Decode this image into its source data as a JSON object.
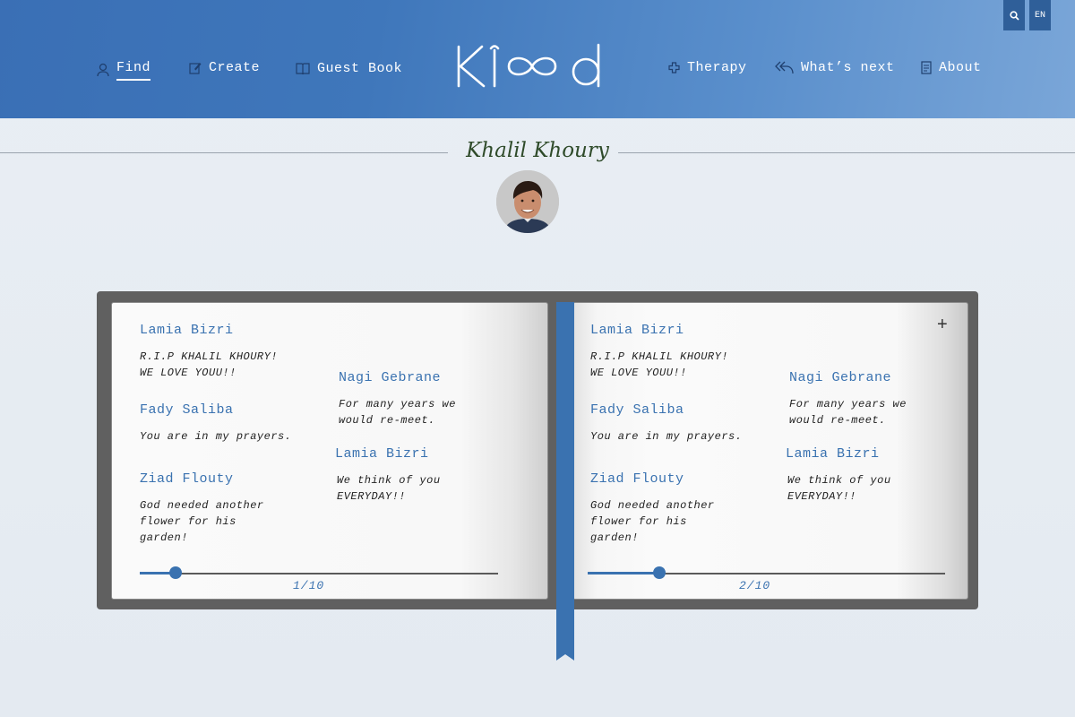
{
  "nav": {
    "find": "Find",
    "create": "Create",
    "guest_book": "Guest Book",
    "therapy": "Therapy",
    "whats_next": "What’s next",
    "about": "About"
  },
  "logo_text": "Khlood",
  "lang": "EN",
  "person": {
    "name": "Khalil Khoury"
  },
  "pages": [
    {
      "entries": [
        {
          "name": "Lamia Bizri",
          "message": "R.I.P KHALIL KHOURY!\nWE LOVE YOUU!!"
        },
        {
          "name": "Fady Saliba",
          "message": "You are in my prayers."
        },
        {
          "name": "Ziad Flouty",
          "message": "God needed another\nflower for his\ngarden!"
        },
        {
          "name": "Nagi Gebrane",
          "message": "For many years we\nwould re-meet."
        },
        {
          "name": "Lamia Bizri",
          "message": "We think of you\nEVERYDAY!!"
        }
      ],
      "page_label": "1/10",
      "progress": 0.1
    },
    {
      "entries": [
        {
          "name": "Lamia Bizri",
          "message": "R.I.P KHALIL KHOURY!\nWE LOVE YOUU!!"
        },
        {
          "name": "Fady Saliba",
          "message": "You are in my prayers."
        },
        {
          "name": "Ziad Flouty",
          "message": "God needed another\nflower for his\ngarden!"
        },
        {
          "name": "Nagi Gebrane",
          "message": "For many years we\nwould re-meet."
        },
        {
          "name": "Lamia Bizri",
          "message": "We think of you\nEVERYDAY!!"
        }
      ],
      "page_label": "2/10",
      "progress": 0.2
    }
  ],
  "icons": {
    "find": "user-icon",
    "create": "edit-icon",
    "guest_book": "book-icon",
    "therapy": "cross-icon",
    "whats_next": "reply-all-icon",
    "about": "document-icon",
    "search": "search-icon",
    "add": "plus-icon"
  },
  "colors": {
    "accent": "#3a72b0",
    "header": "#3f77bb",
    "name": "#2f4b2a"
  }
}
